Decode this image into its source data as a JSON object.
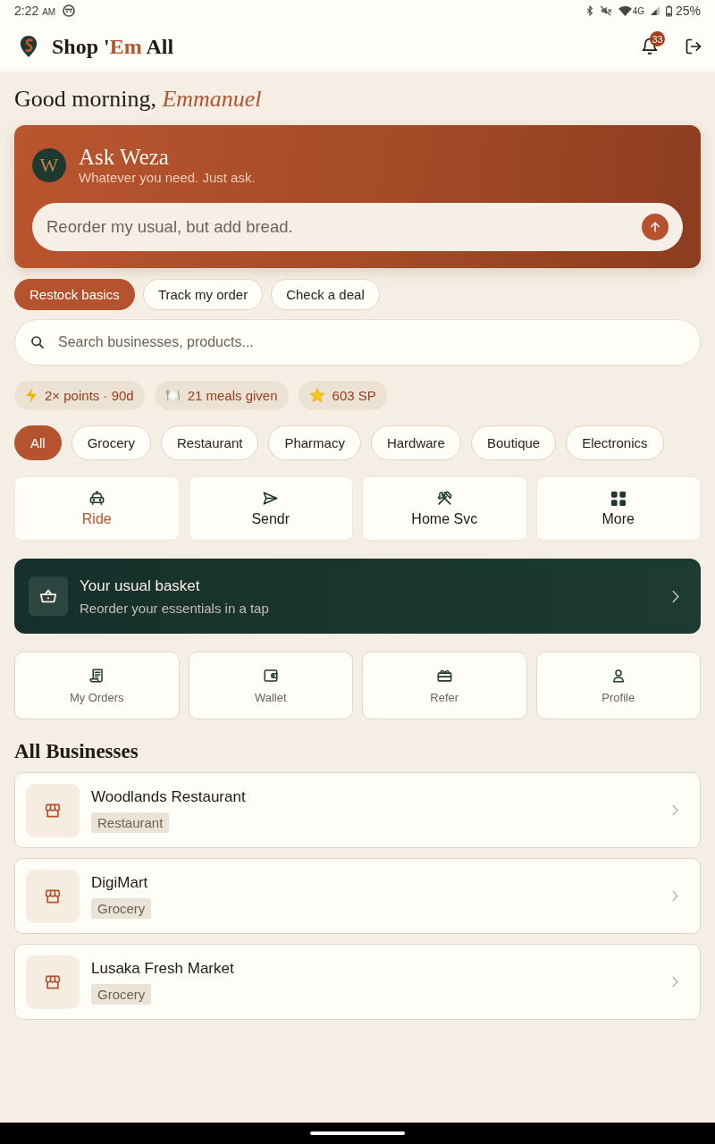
{
  "status_bar": {
    "time": "2:22",
    "period": "AM",
    "network": "4G",
    "battery": "25%"
  },
  "header": {
    "brand": {
      "before": "Shop '",
      "accent": "Em",
      "after": "All"
    },
    "notification_count": "33"
  },
  "greeting": {
    "salutation": "Good morning,",
    "name": "Emmanuel"
  },
  "assistant": {
    "avatar": "W",
    "title": "Ask Weza",
    "subtitle": "Whatever you need. Just ask.",
    "input": {
      "placeholder": "Reorder my usual, but add bread."
    }
  },
  "suggestions": [
    {
      "label": "Restock basics",
      "selected": true
    },
    {
      "label": "Track my order",
      "selected": false
    },
    {
      "label": "Check a deal",
      "selected": false
    }
  ],
  "search": {
    "placeholder": "Search businesses, products..."
  },
  "perks": [
    {
      "kind": "bolt",
      "label": "2× points · 90d"
    },
    {
      "kind": "meal",
      "label": "21 meals given"
    },
    {
      "kind": "star",
      "label": "603 SP"
    }
  ],
  "categories": [
    {
      "label": "All",
      "selected": true
    },
    {
      "label": "Grocery",
      "selected": false
    },
    {
      "label": "Restaurant",
      "selected": false
    },
    {
      "label": "Pharmacy",
      "selected": false
    },
    {
      "label": "Hardware",
      "selected": false
    },
    {
      "label": "Boutique",
      "selected": false
    },
    {
      "label": "Electronics",
      "selected": false
    }
  ],
  "services": [
    {
      "kind": "ride",
      "label": "Ride",
      "selected": true
    },
    {
      "kind": "send",
      "label": "Sendr",
      "selected": false
    },
    {
      "kind": "tools",
      "label": "Home Svc",
      "selected": false
    },
    {
      "kind": "grid",
      "label": "More",
      "selected": false
    }
  ],
  "basket_banner": {
    "title": "Your usual basket",
    "subtitle": "Reorder your essentials in a tap"
  },
  "quick_links": [
    {
      "kind": "receipt",
      "label": "My Orders"
    },
    {
      "kind": "wallet",
      "label": "Wallet"
    },
    {
      "kind": "gift",
      "label": "Refer"
    },
    {
      "kind": "person",
      "label": "Profile"
    }
  ],
  "businesses": {
    "title": "All Businesses",
    "items": [
      {
        "name": "Woodlands Restaurant",
        "category": "Restaurant"
      },
      {
        "name": "DigiMart",
        "category": "Grocery"
      },
      {
        "name": "Lusaka Fresh Market",
        "category": "Grocery"
      }
    ]
  }
}
